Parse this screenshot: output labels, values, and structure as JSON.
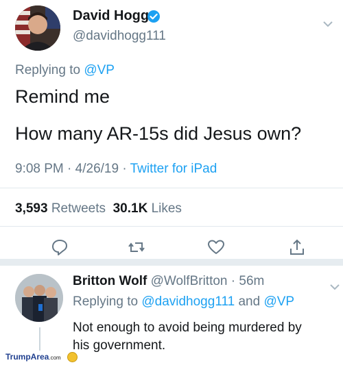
{
  "tweet": {
    "author_name": "David Hogg",
    "handle": "@davidhogg111",
    "replying_prefix": "Replying to ",
    "replying_handle": "@VP",
    "line1": "Remind me",
    "line2": "How many AR-15s did Jesus own?",
    "time": "9:08 PM",
    "date": "4/26/19",
    "source": "Twitter for iPad",
    "retweets_count": "3,593",
    "retweets_label": "Retweets",
    "likes_count": "30.1K",
    "likes_label": "Likes"
  },
  "reply": {
    "author_name": "Britton Wolf",
    "handle": "@WolfBritton",
    "age": "56m",
    "replying_prefix": "Replying to ",
    "replying_handle1": "@davidhogg111",
    "replying_and": " and ",
    "replying_handle2": "@VP",
    "line1": "Not enough to avoid being murdered by",
    "line2": "his government."
  },
  "watermark": {
    "brand": "TrumpArea",
    "tld": ".com"
  },
  "icons": {
    "verified": "verified-badge-icon",
    "reply": "reply-icon",
    "retweet": "retweet-icon",
    "like": "heart-icon",
    "share": "share-icon",
    "menu": "chevron-down-icon"
  },
  "colors": {
    "accent": "#1da1f2",
    "text": "#14171a",
    "muted": "#657786"
  }
}
